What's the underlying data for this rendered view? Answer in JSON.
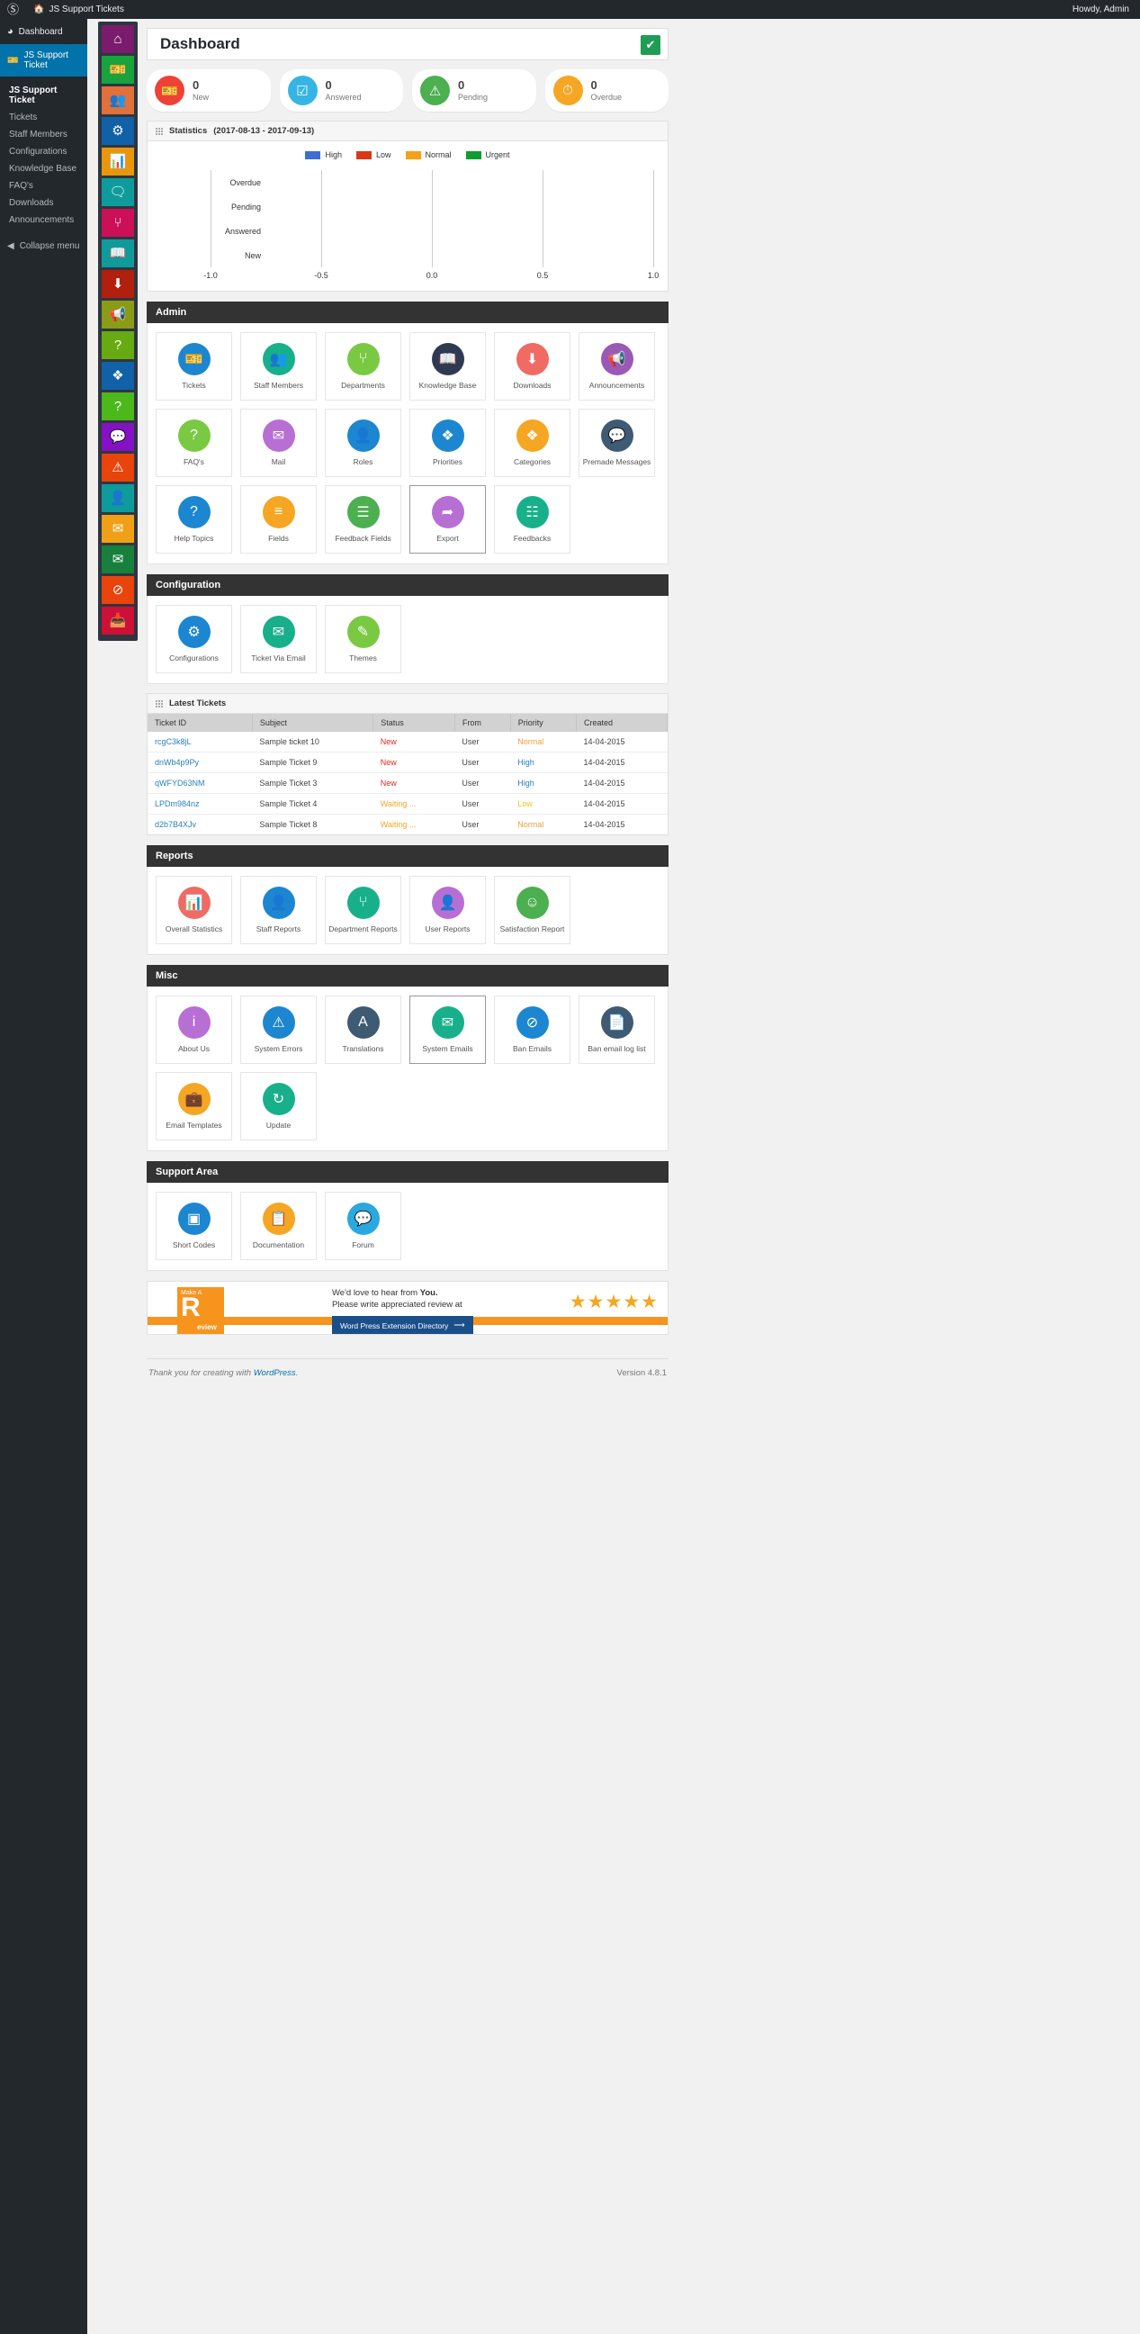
{
  "adminbar": {
    "wp_logo": "wordpress-logo-icon",
    "home_icon": "home-icon",
    "site_name": "JS Support Tickets",
    "howdy": "Howdy, Admin"
  },
  "wpmenu": {
    "dashboard": "Dashboard",
    "current": "JS Support Ticket",
    "submenu": [
      {
        "label": "JS Support Ticket",
        "current": true
      },
      {
        "label": "Tickets",
        "current": false
      },
      {
        "label": "Staff Members",
        "current": false
      },
      {
        "label": "Configurations",
        "current": false
      },
      {
        "label": "Knowledge Base",
        "current": false
      },
      {
        "label": "FAQ's",
        "current": false
      },
      {
        "label": "Downloads",
        "current": false
      },
      {
        "label": "Announcements",
        "current": false
      }
    ],
    "collapse": "Collapse menu"
  },
  "rail": [
    {
      "name": "home-icon",
      "color": "#7b1b6e"
    },
    {
      "name": "ticket-icon",
      "color": "#18a33e"
    },
    {
      "name": "staff-members-icon",
      "color": "#e2703a"
    },
    {
      "name": "configurations-icon",
      "color": "#1061a8"
    },
    {
      "name": "reports-icon",
      "color": "#e8970c"
    },
    {
      "name": "feedback-icon",
      "color": "#0f9b9b"
    },
    {
      "name": "departments-icon",
      "color": "#cc1057"
    },
    {
      "name": "knowledge-base-icon",
      "color": "#0f9b9b"
    },
    {
      "name": "downloads-icon",
      "color": "#b0200d"
    },
    {
      "name": "announcements-icon",
      "color": "#8a9b16"
    },
    {
      "name": "faq-icon",
      "color": "#67ab12"
    },
    {
      "name": "priorities-icon",
      "color": "#1061a8"
    },
    {
      "name": "help-topics-icon",
      "color": "#4db81c"
    },
    {
      "name": "premade-messages-icon",
      "color": "#8511c4"
    },
    {
      "name": "system-errors-icon",
      "color": "#e8440c"
    },
    {
      "name": "roles-icon",
      "color": "#0f9b9b"
    },
    {
      "name": "mail-icon",
      "color": "#f0a017"
    },
    {
      "name": "email-icon",
      "color": "#16803c"
    },
    {
      "name": "ban-emails-icon",
      "color": "#e8440c"
    },
    {
      "name": "ban-email-log-icon",
      "color": "#cc1036"
    }
  ],
  "page": {
    "title": "Dashboard",
    "save_icon": "check-box-icon"
  },
  "stats_cards": [
    {
      "count": "0",
      "label": "New",
      "icon": "ticket-icon",
      "color": "#ef4136"
    },
    {
      "count": "0",
      "label": "Answered",
      "icon": "answered-icon",
      "color": "#36b5e5"
    },
    {
      "count": "0",
      "label": "Pending",
      "icon": "pending-warning-icon",
      "color": "#4caf50"
    },
    {
      "count": "0",
      "label": "Overdue",
      "icon": "overdue-clock-icon",
      "color": "#f5a623"
    }
  ],
  "statistics_panel": {
    "title": "Statistics",
    "range": "(2017-08-13 - 2017-09-13)"
  },
  "chart_data": {
    "type": "bar",
    "title": "Statistics (2017-08-13 - 2017-09-13)",
    "orientation": "horizontal",
    "categories": [
      "Overdue",
      "Pending",
      "Answered",
      "New"
    ],
    "series": [
      {
        "name": "High",
        "color": "#3b6fd4",
        "values": [
          0,
          0,
          0,
          0
        ]
      },
      {
        "name": "Low",
        "color": "#d93a16",
        "values": [
          0,
          0,
          0,
          0
        ]
      },
      {
        "name": "Normal",
        "color": "#f5a217",
        "values": [
          0,
          0,
          0,
          0
        ]
      },
      {
        "name": "Urgent",
        "color": "#0f9d2f",
        "values": [
          0,
          0,
          0,
          0
        ]
      }
    ],
    "xlabel": "",
    "ylabel": "",
    "xticks": [
      "-1.0",
      "-0.5",
      "0.0",
      "0.5",
      "1.0"
    ],
    "xlim": [
      -1.0,
      1.0
    ],
    "grid": false,
    "legend_position": "top-center"
  },
  "sections": {
    "admin": {
      "title": "Admin",
      "tiles": [
        {
          "label": "Tickets",
          "icon": "ticket-icon",
          "color": "#1c86d1"
        },
        {
          "label": "Staff Members",
          "icon": "staff-members-icon",
          "color": "#17b08a"
        },
        {
          "label": "Departments",
          "icon": "departments-icon",
          "color": "#7ac943"
        },
        {
          "label": "Knowledge Base",
          "icon": "book-icon",
          "color": "#2e3a52"
        },
        {
          "label": "Downloads",
          "icon": "download-icon",
          "color": "#ef6b63"
        },
        {
          "label": "Announcements",
          "icon": "megaphone-icon",
          "color": "#9b59b6"
        },
        {
          "label": "FAQ's",
          "icon": "question-icon",
          "color": "#7ac943"
        },
        {
          "label": "Mail",
          "icon": "mail-icon",
          "color": "#b86fd4"
        },
        {
          "label": "Roles",
          "icon": "roles-user-check-icon",
          "color": "#1c86d1"
        },
        {
          "label": "Priorities",
          "icon": "priorities-icon",
          "color": "#1c86d1"
        },
        {
          "label": "Categories",
          "icon": "categories-icon",
          "color": "#f5a623"
        },
        {
          "label": "Premade Messages",
          "icon": "chat-icon",
          "color": "#3f5a73"
        },
        {
          "label": "Help Topics",
          "icon": "help-topics-icon",
          "color": "#1c86d1"
        },
        {
          "label": "Fields",
          "icon": "fields-icon",
          "color": "#f5a623"
        },
        {
          "label": "Feedback Fields",
          "icon": "feedback-fields-icon",
          "color": "#4caf50"
        },
        {
          "label": "Export",
          "icon": "export-icon",
          "color": "#b86fd4",
          "selected": true
        },
        {
          "label": "Feedbacks",
          "icon": "feedbacks-icon",
          "color": "#17b08a"
        }
      ]
    },
    "configuration": {
      "title": "Configuration",
      "tiles": [
        {
          "label": "Configurations",
          "icon": "gear-icon",
          "color": "#1c86d1"
        },
        {
          "label": "Ticket Via Email",
          "icon": "ticket-email-icon",
          "color": "#17b08a"
        },
        {
          "label": "Themes",
          "icon": "themes-brush-icon",
          "color": "#7ac943"
        }
      ]
    },
    "reports": {
      "title": "Reports",
      "tiles": [
        {
          "label": "Overall Statistics",
          "icon": "chart-icon",
          "color": "#ef6b63"
        },
        {
          "label": "Staff Reports",
          "icon": "staff-report-icon",
          "color": "#1c86d1"
        },
        {
          "label": "Department Reports",
          "icon": "department-report-icon",
          "color": "#17b08a"
        },
        {
          "label": "User Reports",
          "icon": "user-report-icon",
          "color": "#b86fd4"
        },
        {
          "label": "Satisfaction Report",
          "icon": "smiley-icon",
          "color": "#4caf50"
        }
      ]
    },
    "misc": {
      "title": "Misc",
      "tiles": [
        {
          "label": "About Us",
          "icon": "info-icon",
          "color": "#b86fd4"
        },
        {
          "label": "System Errors",
          "icon": "warning-icon",
          "color": "#1c86d1"
        },
        {
          "label": "Translations",
          "icon": "translations-icon",
          "color": "#3f5a73"
        },
        {
          "label": "System Emails",
          "icon": "system-emails-icon",
          "color": "#17b08a",
          "selected": true
        },
        {
          "label": "Ban Emails",
          "icon": "ban-emails-icon",
          "color": "#1c86d1"
        },
        {
          "label": "Ban email log list",
          "icon": "email-log-icon",
          "color": "#3f5a73"
        },
        {
          "label": "Email Templates",
          "icon": "email-template-icon",
          "color": "#f5a623"
        },
        {
          "label": "Update",
          "icon": "refresh-icon",
          "color": "#17b08a"
        }
      ]
    },
    "support_area": {
      "title": "Support Area",
      "tiles": [
        {
          "label": "Short Codes",
          "icon": "short-codes-icon",
          "color": "#1c86d1"
        },
        {
          "label": "Documentation",
          "icon": "document-icon",
          "color": "#f5a623"
        },
        {
          "label": "Forum",
          "icon": "forum-icon",
          "color": "#2aa8e0"
        }
      ]
    }
  },
  "latest_tickets": {
    "title": "Latest Tickets",
    "columns": [
      "Ticket ID",
      "Subject",
      "Status",
      "From",
      "Priority",
      "Created"
    ],
    "rows": [
      {
        "id": "rcgC3k8jL",
        "subject": "Sample ticket 10",
        "status": "New",
        "status_kind": "new",
        "from": "User",
        "priority": "Normal",
        "priority_kind": "normal",
        "created": "14-04-2015"
      },
      {
        "id": "dnWb4p9Py",
        "subject": "Sample Ticket 9",
        "status": "New",
        "status_kind": "new",
        "from": "User",
        "priority": "High",
        "priority_kind": "high",
        "created": "14-04-2015"
      },
      {
        "id": "qWFYD63NM",
        "subject": "Sample Ticket 3",
        "status": "New",
        "status_kind": "new",
        "from": "User",
        "priority": "High",
        "priority_kind": "high",
        "created": "14-04-2015"
      },
      {
        "id": "LPDm984nz",
        "subject": "Sample Ticket 4",
        "status": "Waiting ...",
        "status_kind": "wait",
        "from": "User",
        "priority": "Low",
        "priority_kind": "low",
        "created": "14-04-2015"
      },
      {
        "id": "d2b7B4XJv",
        "subject": "Sample Ticket 8",
        "status": "Waiting ...",
        "status_kind": "wait",
        "from": "User",
        "priority": "Normal",
        "priority_kind": "normal",
        "created": "14-04-2015"
      }
    ]
  },
  "review_banner": {
    "badge_top": "Make A",
    "badge_letter": "R",
    "badge_rest": "eview",
    "line1_a": "We'd love to hear from ",
    "line1_b": "You.",
    "line2": "Please write appreciated review at",
    "button": "Word Press Extension Directory",
    "stars": "★★★★★"
  },
  "footer": {
    "thanks_pre": "Thank you for creating with ",
    "thanks_link": "WordPress",
    "thanks_post": ".",
    "version": "Version 4.8.1"
  }
}
